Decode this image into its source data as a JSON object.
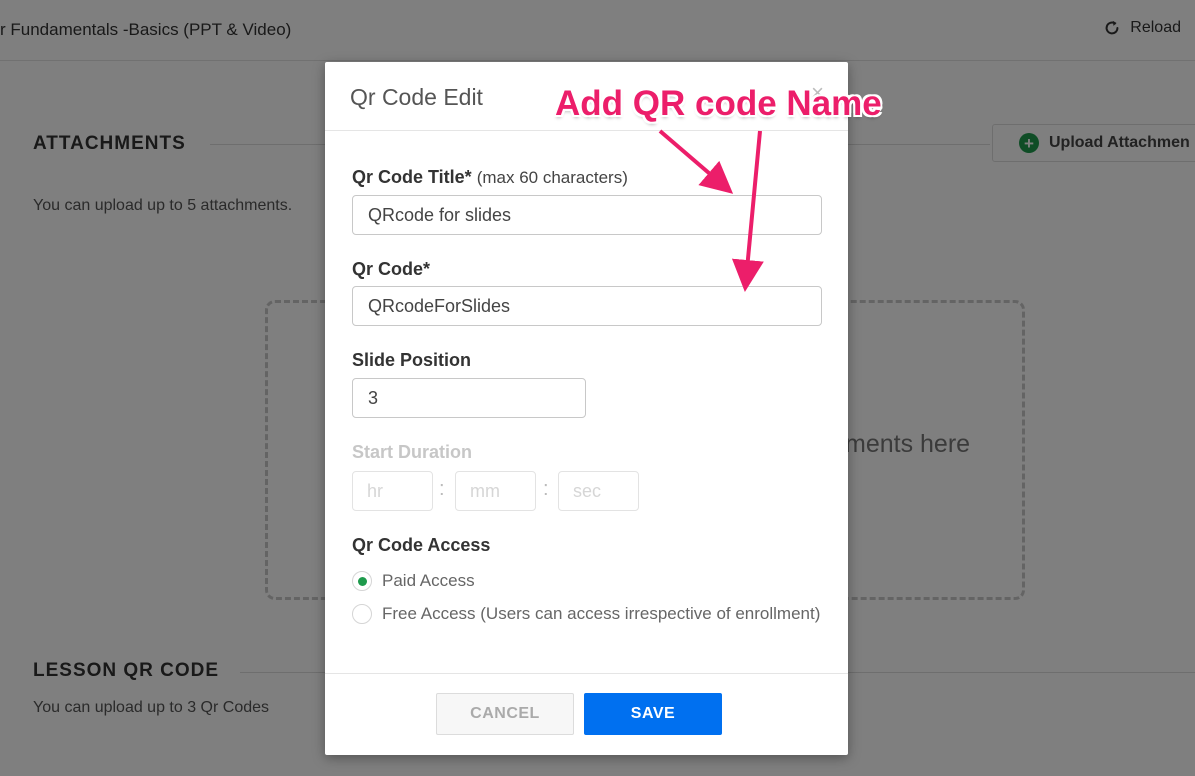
{
  "header": {
    "course_title": "r Fundamentals -Basics (PPT & Video)",
    "reload_label": "Reload"
  },
  "attachments": {
    "heading": "ATTACHMENTS",
    "subtext": "You can upload up to 5 attachments.",
    "upload_button": "Upload Attachmen",
    "drop_text": "ments here"
  },
  "qr_section": {
    "heading": "LESSON QR CODE",
    "subtext": "You can upload up to 3 Qr Codes"
  },
  "modal": {
    "title": "Qr Code Edit",
    "close_icon": "×",
    "title_field": {
      "label": "Qr Code Title*",
      "note": "(max 60 characters)",
      "value": "QRcode for slides"
    },
    "code_field": {
      "label": "Qr Code*",
      "value": "QRcodeForSlides"
    },
    "slide_position": {
      "label": "Slide Position",
      "value": "3"
    },
    "start_duration": {
      "label": "Start Duration",
      "hr_placeholder": "hr",
      "mm_placeholder": "mm",
      "sec_placeholder": "sec",
      "separator": ":"
    },
    "access": {
      "label": "Qr Code Access",
      "options": [
        {
          "label": "Paid Access",
          "selected": true
        },
        {
          "label": "Free Access (Users can access irrespective of enrollment)",
          "selected": false
        }
      ]
    },
    "cancel_label": "CANCEL",
    "save_label": "SAVE"
  },
  "annotation": {
    "text": "Add QR code Name",
    "color": "#ec1e6a"
  },
  "colors": {
    "primary": "#0070f0",
    "success": "#1e9a4c"
  }
}
